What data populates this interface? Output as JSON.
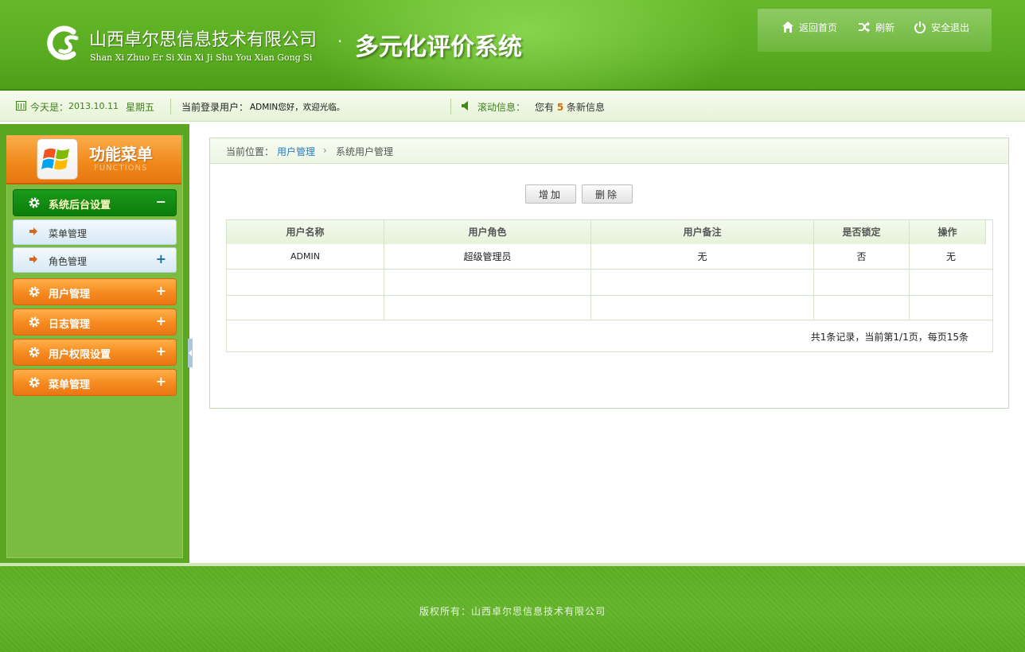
{
  "header": {
    "company_cn": "山西卓尔思信息技术有限公司",
    "company_pinyin": "Shan Xi Zhuo Er Si Xin Xi Ji Shu You Xian Gong Si",
    "dot": "·",
    "system_title": "多元化评价系统",
    "links": [
      {
        "label": "返回首页",
        "icon": "home-icon"
      },
      {
        "label": "刷新",
        "icon": "refresh-icon"
      },
      {
        "label": "安全退出",
        "icon": "power-icon"
      }
    ]
  },
  "infobar": {
    "date_label": "今天是：",
    "date_value": "2013.10.11",
    "weekday": "星期五",
    "login_label": "当前登录用户：",
    "login_value": "ADMIN您好，欢迎光临。",
    "scroll_label": "滚动信息：",
    "msg_prefix": "您有",
    "msg_count": "5",
    "msg_suffix": "条新信息"
  },
  "sidebar": {
    "menu_title": "功能菜单",
    "menu_subtitle": "FUNCTIONS",
    "groups": [
      {
        "label": "系统后台设置",
        "toggle": "−",
        "active": true
      },
      {
        "label": "用户管理",
        "toggle": "+"
      },
      {
        "label": "日志管理",
        "toggle": "+"
      },
      {
        "label": "用户权限设置",
        "toggle": "+"
      },
      {
        "label": "菜单管理",
        "toggle": "+"
      }
    ],
    "subitems": [
      {
        "label": "菜单管理",
        "toggle": ""
      },
      {
        "label": "角色管理",
        "toggle": "+"
      }
    ]
  },
  "main": {
    "breadcrumb": {
      "prefix": "当前位置：",
      "link": "用户管理",
      "sep": "›",
      "current": "系统用户管理"
    },
    "buttons": {
      "add": "增加",
      "delete": "删除"
    },
    "table": {
      "headers": [
        "用户名称",
        "用户角色",
        "用户备注",
        "是否锁定",
        "操作"
      ],
      "rows": [
        [
          "ADMIN",
          "超级管理员",
          "无",
          "否",
          "无"
        ]
      ]
    },
    "pager": "共1条记录，当前第1/1页，每页15条"
  },
  "footer": {
    "copyright": "版权所有：山西卓尔思信息技术有限公司"
  },
  "colors": {
    "header_green": "#5aad21",
    "menu_orange": "#f58a1e",
    "active_green": "#0b7d0b",
    "link_blue": "#2a7abf"
  }
}
